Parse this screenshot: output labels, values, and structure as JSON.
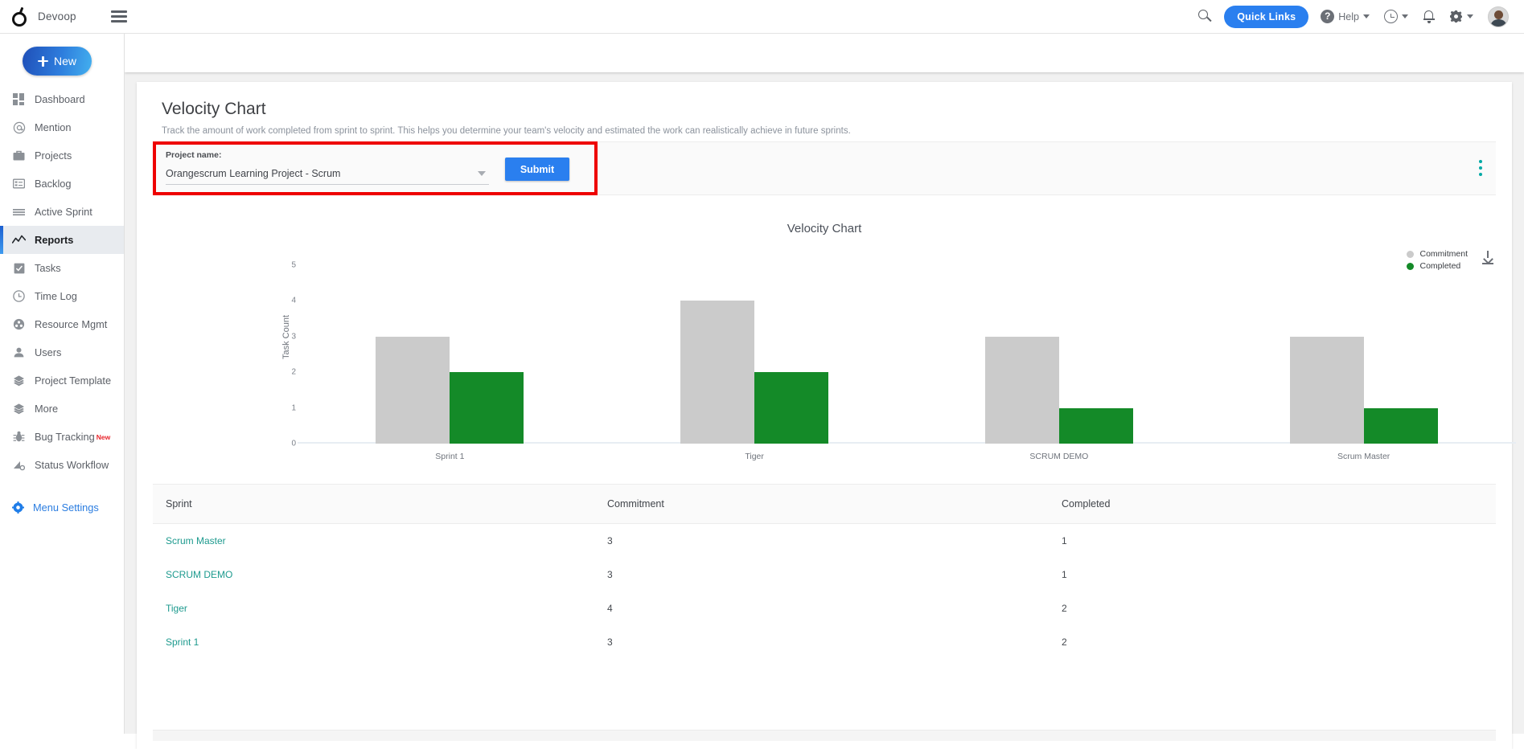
{
  "topbar": {
    "brand_name": "Devoop",
    "search_icon": "search-icon",
    "quick_links_label": "Quick Links",
    "help_label": "Help",
    "help_icon": "question-mark-icon",
    "clock_icon": "clock-icon",
    "bell_icon": "bell-icon",
    "gear_icon": "gear-icon",
    "avatar_icon": "user-avatar"
  },
  "sidebar": {
    "new_button_label": "New",
    "items": [
      {
        "label": "Dashboard",
        "icon": "dashboard-grid-icon",
        "active": false
      },
      {
        "label": "Mention",
        "icon": "at-sign-icon",
        "active": false
      },
      {
        "label": "Projects",
        "icon": "briefcase-icon",
        "active": false
      },
      {
        "label": "Backlog",
        "icon": "backlog-list-icon",
        "active": false
      },
      {
        "label": "Active Sprint",
        "icon": "lines-icon",
        "active": false
      },
      {
        "label": "Reports",
        "icon": "trend-line-icon",
        "active": true
      },
      {
        "label": "Tasks",
        "icon": "clipboard-check-icon",
        "active": false
      },
      {
        "label": "Time Log",
        "icon": "clock-icon",
        "active": false
      },
      {
        "label": "Resource Mgmt",
        "icon": "resource-people-icon",
        "active": false
      },
      {
        "label": "Users",
        "icon": "person-icon",
        "active": false
      },
      {
        "label": "Project Template",
        "icon": "layers-icon",
        "active": false
      },
      {
        "label": "More",
        "icon": "layers-icon",
        "active": false
      },
      {
        "label": "Bug Tracking",
        "icon": "bug-icon",
        "active": false,
        "badge": "New"
      },
      {
        "label": "Status Workflow",
        "icon": "workflow-icon",
        "active": false
      }
    ],
    "menu_settings_label": "Menu Settings",
    "menu_settings_icon": "gear-icon"
  },
  "main": {
    "page_title": "Velocity Chart",
    "page_subtitle": "Track the amount of work completed from sprint to sprint. This helps you determine your team's velocity and estimated the work can realistically achieve in future sprints."
  },
  "filter": {
    "project_label": "Project name:",
    "project_value": "Orangescrum Learning Project - Scrum",
    "submit_label": "Submit",
    "kebab_icon": "more-vertical-icon",
    "highlight_color": "#ee0000"
  },
  "chart_data": {
    "type": "bar",
    "title": "Velocity Chart",
    "xlabel": "",
    "ylabel": "Task Count",
    "categories": [
      "Sprint 1",
      "Tiger",
      "SCRUM DEMO",
      "Scrum Master"
    ],
    "series": [
      {
        "name": "Commitment",
        "color": "#cbcbcb",
        "values": [
          3,
          4,
          3,
          3
        ]
      },
      {
        "name": "Completed",
        "color": "#148a28",
        "values": [
          2,
          2,
          1,
          1
        ]
      }
    ],
    "ylim": [
      0,
      5
    ],
    "yticks": [
      "0",
      "1",
      "2",
      "3",
      "4",
      "5"
    ],
    "grid": false,
    "legend_position": "top-right",
    "download_icon": "download-icon"
  },
  "table": {
    "columns": [
      "Sprint",
      "Commitment",
      "Completed"
    ],
    "rows": [
      {
        "sprint": "Scrum Master",
        "commitment": "3",
        "completed": "1"
      },
      {
        "sprint": "SCRUM DEMO",
        "commitment": "3",
        "completed": "1"
      },
      {
        "sprint": "Tiger",
        "commitment": "4",
        "completed": "2"
      },
      {
        "sprint": "Sprint 1",
        "commitment": "3",
        "completed": "2"
      }
    ]
  }
}
